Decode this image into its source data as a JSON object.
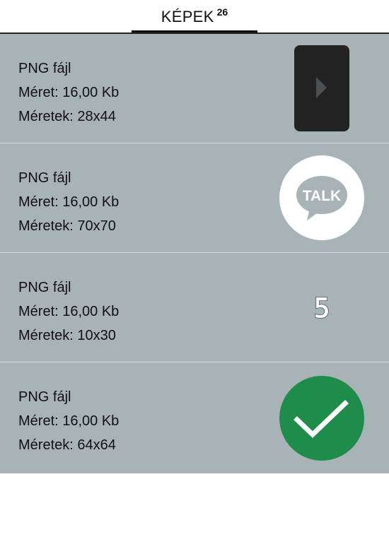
{
  "header": {
    "title": "KÉPEK",
    "count": "26"
  },
  "images": [
    {
      "type": "PNG fájl",
      "size": "Méret: 16,00 Kb",
      "dimensions": "Méretek: 28x44",
      "icon": "play-arrow-icon"
    },
    {
      "type": "PNG fájl",
      "size": "Méret: 16,00 Kb",
      "dimensions": "Méretek: 70x70",
      "icon": "talk-chat-icon",
      "icon_text": "TALK"
    },
    {
      "type": "PNG fájl",
      "size": "Méret: 16,00 Kb",
      "dimensions": "Méretek: 10x30",
      "icon": "digit-five-icon",
      "icon_text": "5"
    },
    {
      "type": "PNG fájl",
      "size": "Méret: 16,00 Kb",
      "dimensions": "Méretek: 64x64",
      "icon": "checkmark-icon"
    }
  ],
  "colors": {
    "row_background": "#a8b3b6",
    "check_green": "#1e8c4a",
    "play_dark": "#222222"
  }
}
